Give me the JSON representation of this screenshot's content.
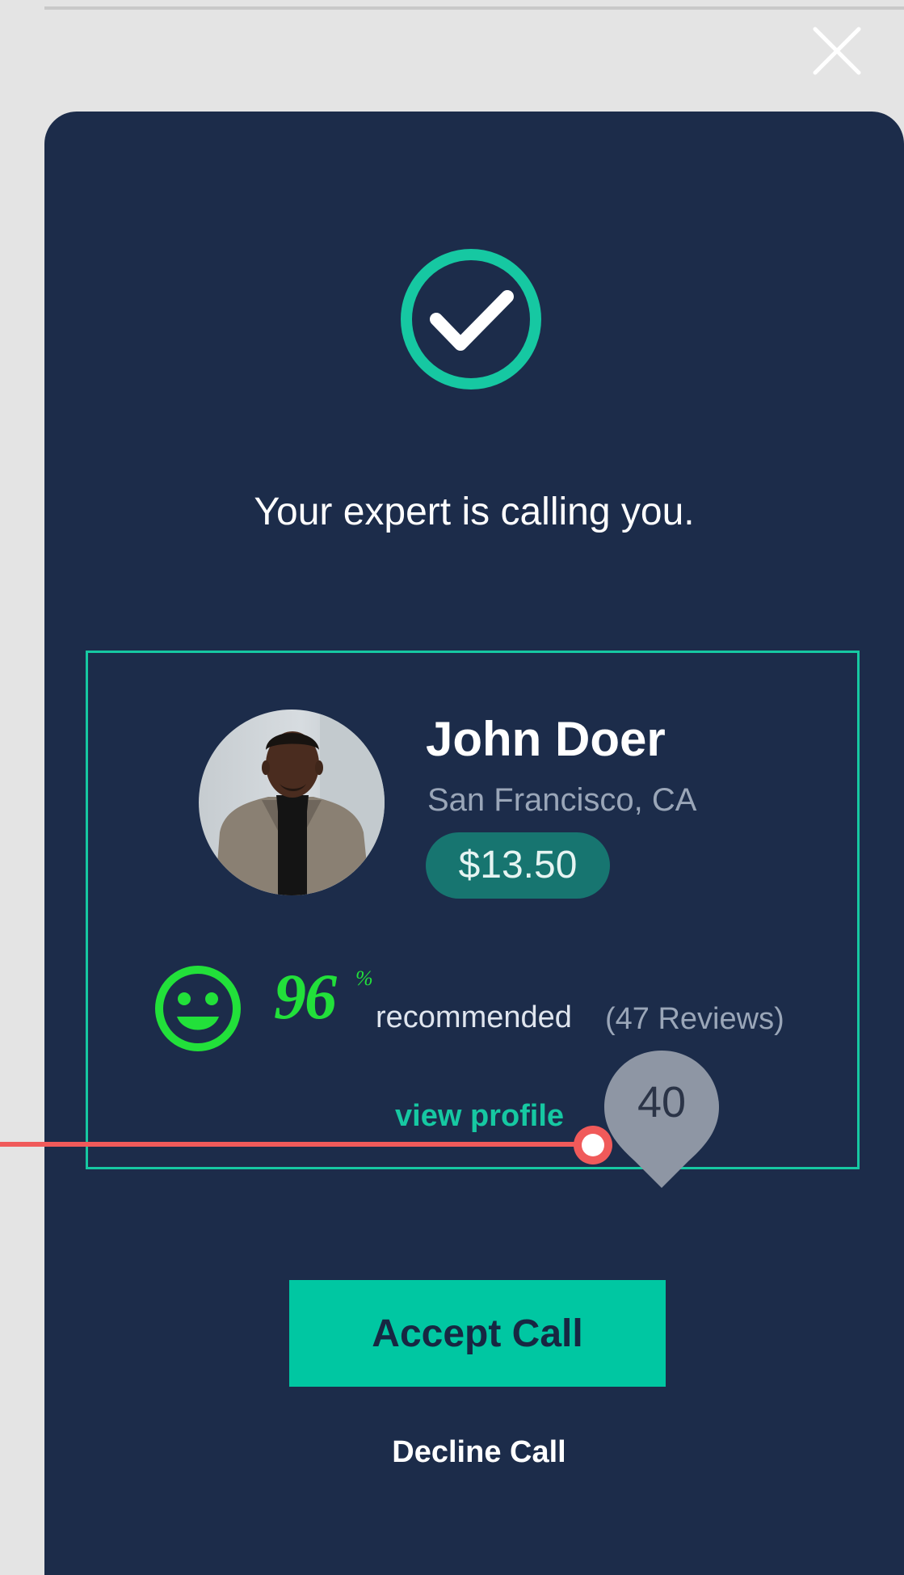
{
  "modal": {
    "headline": "Your expert is calling you."
  },
  "expert": {
    "name": "John Doer",
    "location": "San Francisco, CA",
    "price": "$13.50",
    "rating_percent": "96",
    "rating_percent_sign": "%",
    "recommended_label": "recommended",
    "reviews": "(47 Reviews)",
    "view_profile_label": "view profile"
  },
  "annotation": {
    "value": "40"
  },
  "actions": {
    "accept_label": "Accept Call",
    "decline_label": "Decline Call"
  },
  "colors": {
    "modal_background": "#1c2c4a",
    "accent_teal": "#16c8a2",
    "accept_button": "#00c7a2",
    "rating_green": "#22e03a",
    "price_badge": "#177570",
    "annotation_red": "#f05a5a"
  },
  "icons": {
    "close": "close-icon",
    "success": "checkmark-circle-icon",
    "satisfaction": "smiley-face-icon"
  }
}
